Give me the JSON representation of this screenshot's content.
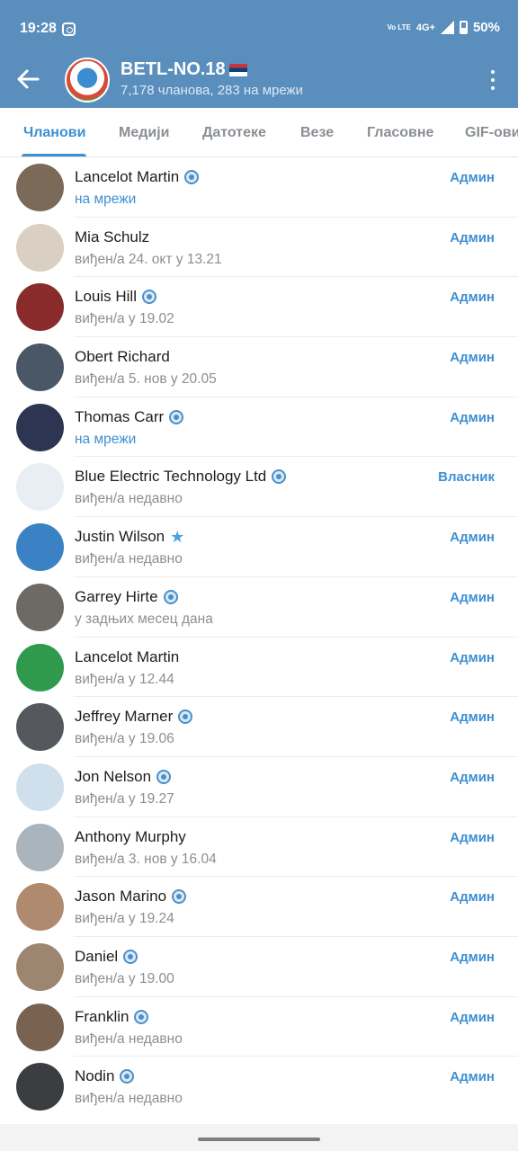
{
  "status_bar": {
    "time": "19:28",
    "volte": "Vo LTE",
    "network": "4G+",
    "battery": "50%"
  },
  "header": {
    "title": "BETL-NO.18",
    "subtitle": "7,178 чланова, 283 на мрежи"
  },
  "tabs": [
    {
      "label": "Чланови"
    },
    {
      "label": "Медији"
    },
    {
      "label": "Датотеке"
    },
    {
      "label": "Везе"
    },
    {
      "label": "Гласовне"
    },
    {
      "label": "GIF-ови"
    }
  ],
  "members": [
    {
      "name": "Lancelot Martin",
      "status": "на мрежи",
      "role": "Админ",
      "avatar_color": "#7b6a58"
    },
    {
      "name": "Mia Schulz",
      "status": "виђен/а 24. окт у 13.21",
      "role": "Админ",
      "avatar_color": "#d9cfc3"
    },
    {
      "name": "Louis Hill",
      "status": "виђен/а у 19.02",
      "role": "Админ",
      "avatar_color": "#8a2b2b"
    },
    {
      "name": "Obert Richard",
      "status": "виђен/а 5. нов у 20.05",
      "role": "Админ",
      "avatar_color": "#4a5766"
    },
    {
      "name": "Thomas Carr",
      "status": "на мрежи",
      "role": "Админ",
      "avatar_color": "#2d3552"
    },
    {
      "name": "Blue Electric Technology Ltd",
      "status": "виђен/а недавно",
      "role": "Власник",
      "avatar_color": "#e8eef4"
    },
    {
      "name": "Justin Wilson",
      "status": "виђен/а недавно",
      "role": "Админ",
      "avatar_color": "#3a82c4"
    },
    {
      "name": "Garrey Hirte",
      "status": "у задњих месец дана",
      "role": "Админ",
      "avatar_color": "#6d6a63"
    },
    {
      "name": "Lancelot Martin",
      "status": "виђен/а у 12.44",
      "role": "Админ",
      "avatar_color": "#2f9a4c"
    },
    {
      "name": "Jeffrey Marner",
      "status": "виђен/а у 19.06",
      "role": "Админ",
      "avatar_color": "#55595e"
    },
    {
      "name": "Jon Nelson",
      "status": "виђен/а у 19.27",
      "role": "Админ",
      "avatar_color": "#cfe0ec"
    },
    {
      "name": "Anthony Murphy",
      "status": "виђен/а 3. нов у 16.04",
      "role": "Админ",
      "avatar_color": "#a9b4bd"
    },
    {
      "name": "Jason Marino",
      "status": "виђен/а у 19.24",
      "role": "Админ",
      "avatar_color": "#b08a6e"
    },
    {
      "name": "Daniel",
      "status": "виђен/а у 19.00",
      "role": "Админ",
      "avatar_color": "#9c8670"
    },
    {
      "name": "Franklin",
      "status": "виђен/а недавно",
      "role": "Админ",
      "avatar_color": "#7a6250"
    },
    {
      "name": "Nodin",
      "status": "виђен/а недавно",
      "role": "Админ",
      "avatar_color": "#3b3d40"
    }
  ],
  "colors": {
    "header": "#5a8fbd",
    "accent": "#3e8fd2",
    "muted": "#8a8f94"
  }
}
